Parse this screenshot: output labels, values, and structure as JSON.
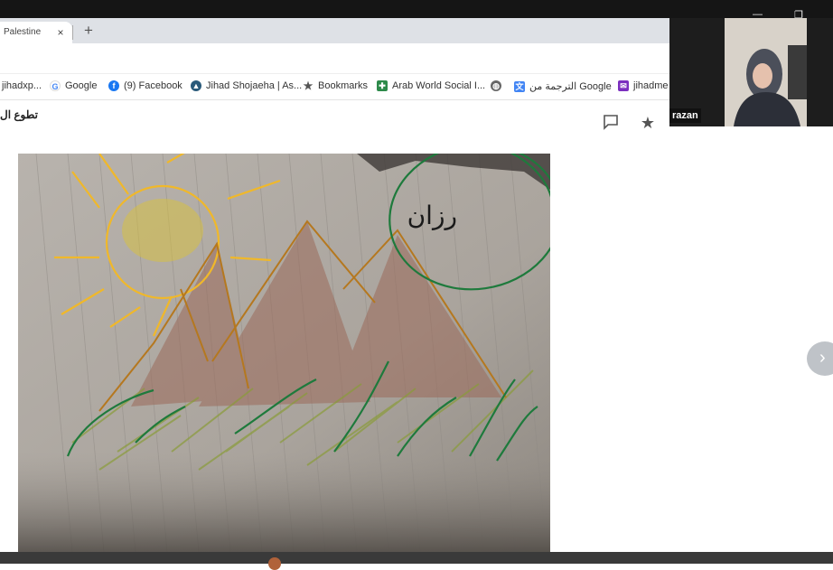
{
  "browser": {
    "tab_title": "Palestine",
    "tab_close": "×",
    "new_tab": "+"
  },
  "bookmarks": [
    {
      "label": "jihadxp...",
      "icon": "bookmark-icon"
    },
    {
      "label": "Google",
      "icon": "google-icon"
    },
    {
      "label": "(9) Facebook",
      "icon": "facebook-icon"
    },
    {
      "label": "Jihad Shojaeha | As...",
      "icon": "site-icon"
    },
    {
      "label": "Bookmarks",
      "icon": "star-icon"
    },
    {
      "label": "Arab World Social I...",
      "icon": "site-icon"
    },
    {
      "label": "",
      "icon": "globe-icon"
    },
    {
      "label": "الترجمة من Google",
      "icon": "translate-icon"
    },
    {
      "label": "jihadme",
      "icon": "mail-icon"
    }
  ],
  "page": {
    "title": "تطوع ال"
  },
  "drawing": {
    "caption": "رزان"
  },
  "video": {
    "participant_name": "razan"
  },
  "colors": {
    "tab_strip": "#dee1e6",
    "facebook": "#1877f2",
    "sun": "#f2c02b",
    "moon": "#1e7a3c",
    "pyramid": "#8b5a3c"
  }
}
